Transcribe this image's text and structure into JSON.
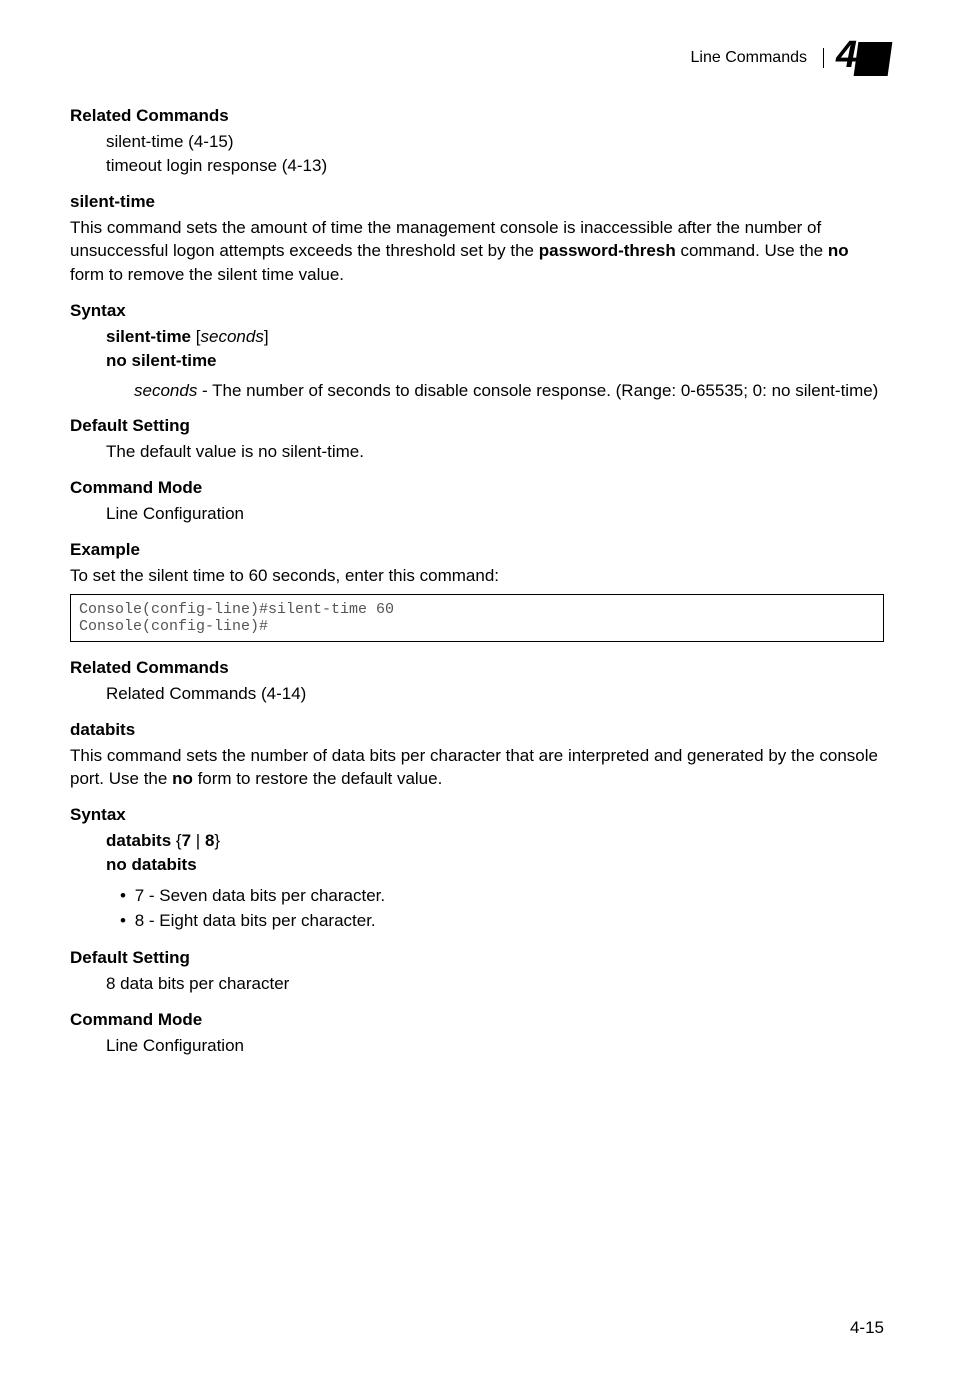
{
  "header": {
    "section": "Line Commands",
    "chapter": "4"
  },
  "relatedCommands1": {
    "heading": "Related Commands",
    "line1": "silent-time (4-15)",
    "line2": "timeout login response (4-13)"
  },
  "silentTime": {
    "heading": "silent-time",
    "paraPart1": "This command sets the amount of time the management console is inaccessible after the number of unsuccessful logon attempts exceeds the threshold set by the ",
    "paraBold1": "password-thresh",
    "paraPart2": " command. Use the ",
    "paraBold2": "no",
    "paraPart3": " form to remove the silent time value."
  },
  "syntax1": {
    "heading": "Syntax",
    "line1a": "silent-time",
    "line1b": "seconds",
    "line2": "no silent-time",
    "descItalic": "seconds",
    "descText": " - The number of seconds to disable console response. (Range: 0-65535; 0: no silent-time)"
  },
  "defaultSetting1": {
    "heading": "Default Setting",
    "text": "The default value is no silent-time."
  },
  "commandMode1": {
    "heading": "Command Mode",
    "text": "Line Configuration"
  },
  "example1": {
    "heading": "Example",
    "text": "To set the silent time to 60 seconds, enter this command:",
    "code": "Console(config-line)#silent-time 60\nConsole(config-line)#"
  },
  "relatedCommands2": {
    "heading": "Related Commands",
    "text": "Related Commands (4-14)"
  },
  "databits": {
    "heading": "databits",
    "paraPart1": "This command sets the number of data bits per character that are interpreted and generated by the console port. Use the ",
    "paraBold": "no",
    "paraPart2": " form to restore the default value."
  },
  "syntax2": {
    "heading": "Syntax",
    "line1a": "databits",
    "line1b": "7",
    "line1c": "8",
    "line2": "no databits",
    "bullet1": "7 - Seven data bits per character.",
    "bullet2": "8 - Eight data bits per character."
  },
  "defaultSetting2": {
    "heading": "Default Setting",
    "text": "8 data bits per character"
  },
  "commandMode2": {
    "heading": "Command Mode",
    "text": "Line Configuration"
  },
  "footer": {
    "pageNum": "4-15"
  }
}
